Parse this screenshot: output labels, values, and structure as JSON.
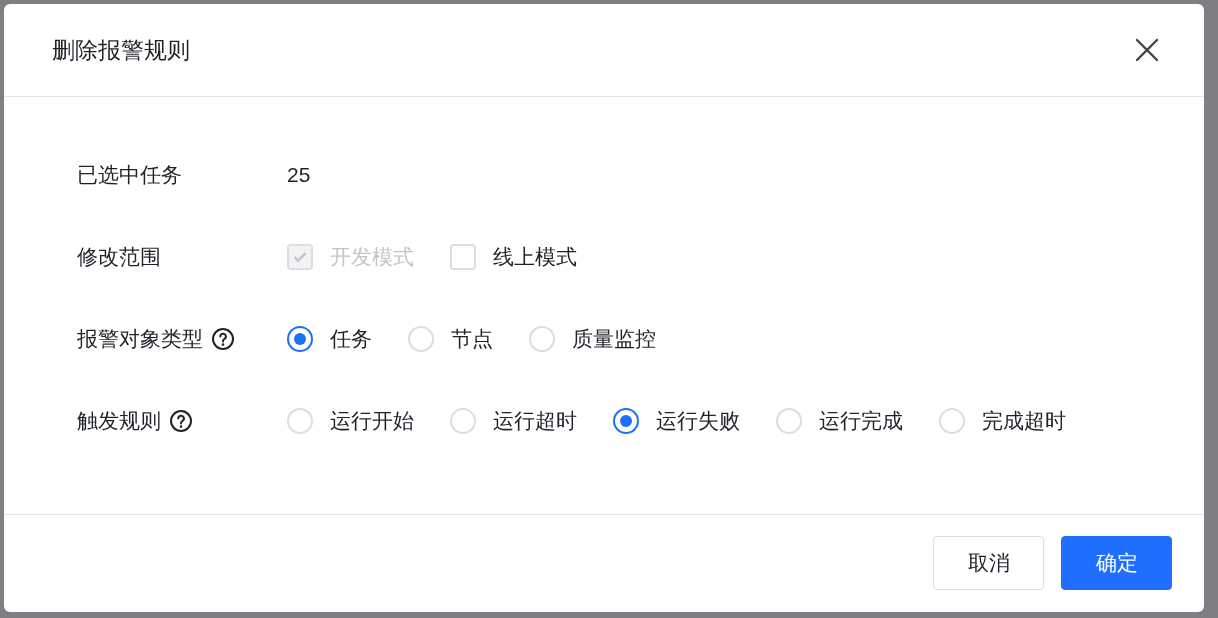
{
  "dialog": {
    "title": "删除报警规则"
  },
  "fields": [
    {
      "label": "已选中任务",
      "kind": "text",
      "help": false,
      "value": "25"
    },
    {
      "label": "修改范围",
      "kind": "checkbox",
      "help": false,
      "options": [
        {
          "label": "开发模式",
          "checked": true,
          "disabled": true
        },
        {
          "label": "线上模式",
          "checked": false,
          "disabled": false
        }
      ]
    },
    {
      "label": "报警对象类型",
      "kind": "radio",
      "help": true,
      "options": [
        {
          "label": "任务",
          "selected": true
        },
        {
          "label": "节点",
          "selected": false
        },
        {
          "label": "质量监控",
          "selected": false
        }
      ]
    },
    {
      "label": "触发规则",
      "kind": "radio",
      "help": true,
      "options": [
        {
          "label": "运行开始",
          "selected": false
        },
        {
          "label": "运行超时",
          "selected": false
        },
        {
          "label": "运行失败",
          "selected": true
        },
        {
          "label": "运行完成",
          "selected": false
        },
        {
          "label": "完成超时",
          "selected": false
        }
      ]
    }
  ],
  "buttons": [
    {
      "label": "取消",
      "kind": "default"
    },
    {
      "label": "确定",
      "kind": "primary"
    }
  ]
}
